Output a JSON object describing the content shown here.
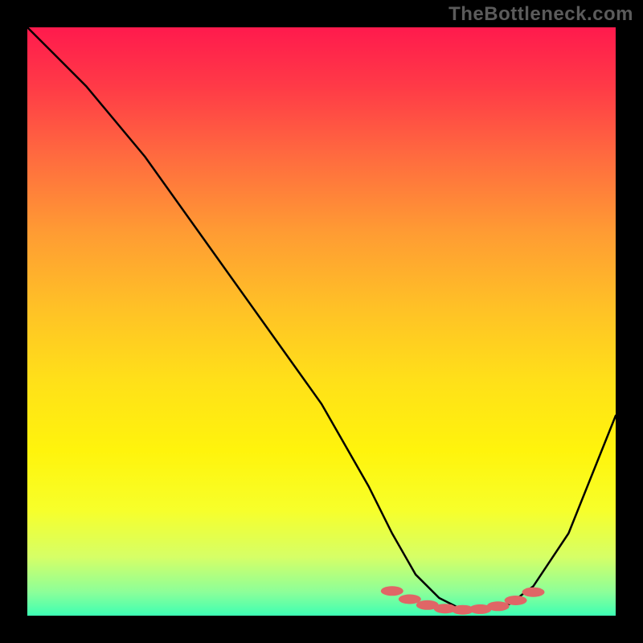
{
  "watermark_text": "TheBottleneck.com",
  "chart_data": {
    "type": "line",
    "title": "",
    "xlabel": "",
    "ylabel": "",
    "xlim": [
      0,
      100
    ],
    "ylim": [
      0,
      100
    ],
    "grid": false,
    "legend": null,
    "annotations": [],
    "series": [
      {
        "name": "bottleneck-curve",
        "color": "#000000",
        "x": [
          0,
          4,
          10,
          20,
          30,
          40,
          50,
          58,
          62,
          66,
          70,
          74,
          78,
          82,
          86,
          92,
          100
        ],
        "values": [
          100,
          96,
          90,
          78,
          64,
          50,
          36,
          22,
          14,
          7,
          3,
          1,
          1,
          2,
          5,
          14,
          34
        ]
      }
    ],
    "markers": {
      "name": "highlighted-range",
      "color": "#e06666",
      "x": [
        62,
        65,
        68,
        71,
        74,
        77,
        80,
        83,
        86
      ],
      "values": [
        4.2,
        2.8,
        1.8,
        1.2,
        1.0,
        1.1,
        1.6,
        2.6,
        4.0
      ]
    },
    "background": {
      "type": "vertical-gradient",
      "stops": [
        {
          "pos": 0.0,
          "color": "#ff1a4d"
        },
        {
          "pos": 0.22,
          "color": "#ff6b3f"
        },
        {
          "pos": 0.48,
          "color": "#ffc226"
        },
        {
          "pos": 0.72,
          "color": "#fff40c"
        },
        {
          "pos": 0.9,
          "color": "#d6ff66"
        },
        {
          "pos": 1.0,
          "color": "#3dffb3"
        }
      ]
    }
  }
}
